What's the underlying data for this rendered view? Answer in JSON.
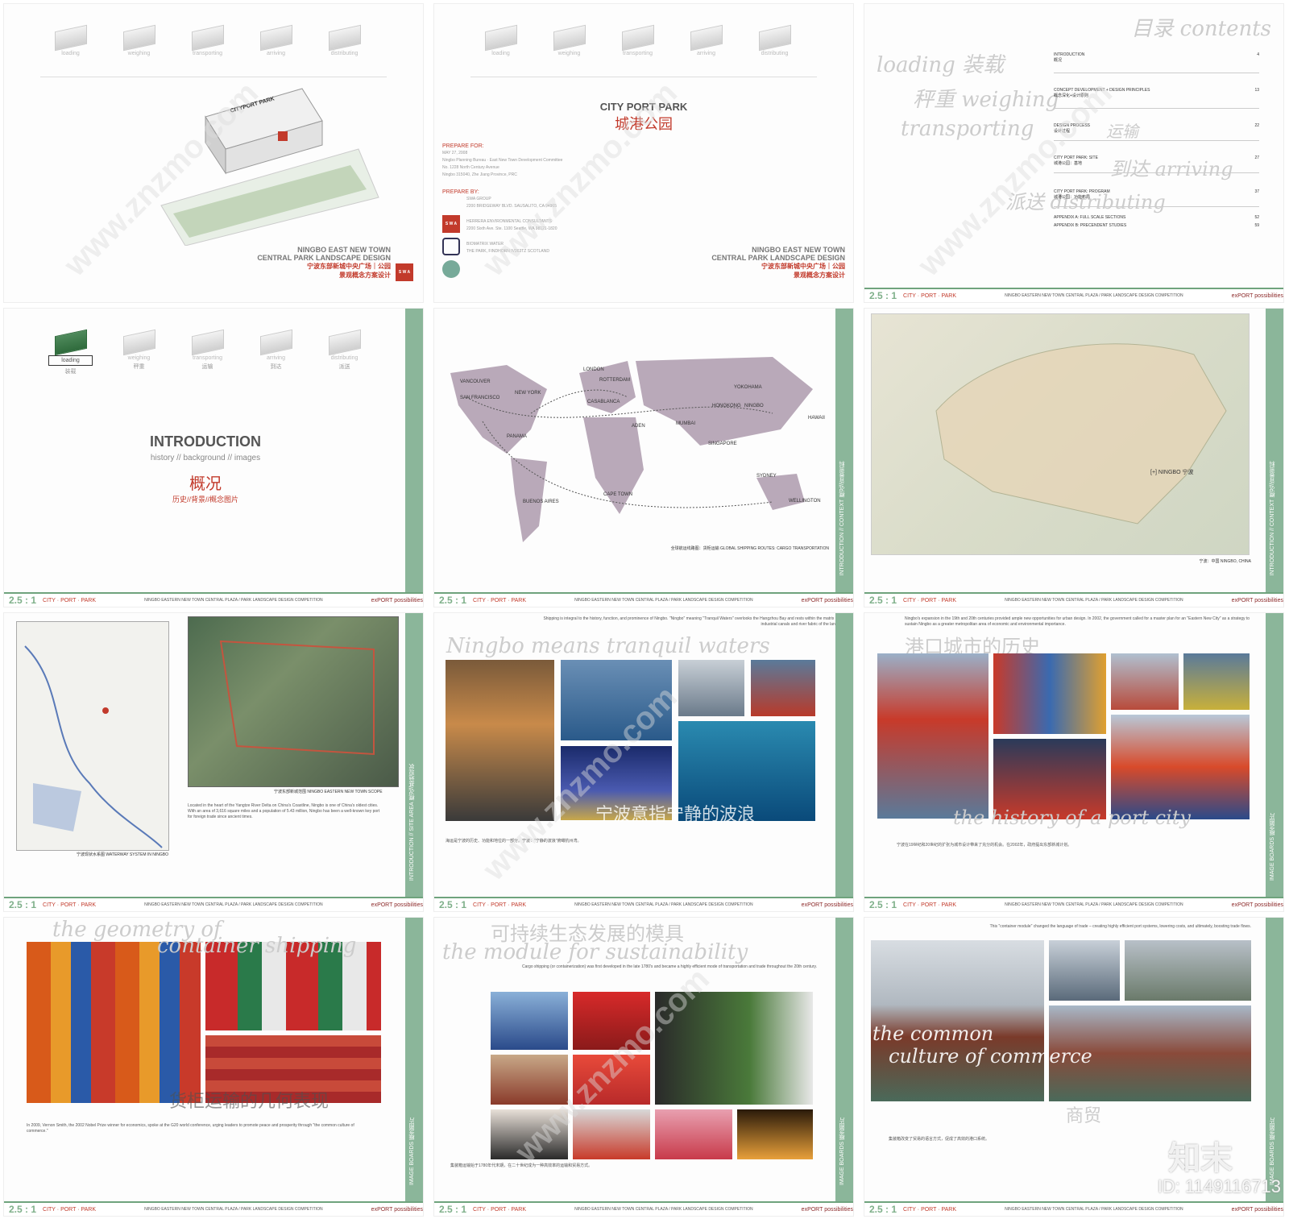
{
  "steps": [
    {
      "en": "loading",
      "cn": "装载"
    },
    {
      "en": "weighing",
      "cn": "秤重"
    },
    {
      "en": "transporting",
      "cn": "运输"
    },
    {
      "en": "arriving",
      "cn": "到达"
    },
    {
      "en": "distributing",
      "cn": "派送"
    }
  ],
  "cover": {
    "t1": "NINGBO EAST NEW TOWN",
    "t2": "CENTRAL PARK LANDSCAPE DESIGN",
    "t3": "宁波东部新城中央广场｜公园",
    "t4": "景观概念方案设计",
    "box_label": "CITYPORT PARK",
    "swa": "S W A"
  },
  "title_page": {
    "en": "CITY PORT PARK",
    "cn": "城港公园",
    "prepare_for": "PREPARE FOR:",
    "prepare_by": "PREPARE BY:",
    "date": "MAY 27, 2008",
    "client1": "Ningbo Planning Bureau · East New Town Development Committee",
    "client2": "No. 1228 North Century Avenue",
    "client3": "Ningbo 315040, Zhe Jiang Province, PRC",
    "by1": "SWA GROUP",
    "by2": "2200 BRIDGEWAY BLVD. SAUSALITO, CA 94965",
    "by3": "HERRERA ENVIRONMENTAL CONSULTANTS",
    "by4": "2200 Sixth Ave. Ste. 1100 Seattle, WA 98121-1820",
    "by5": "BIOMATRIX WATER",
    "by6": "THE PARK, FINDHORN IV363TZ SCOTLAND"
  },
  "contents": {
    "title": "目录 contents",
    "words": [
      "loading 装载",
      "秤重 weighing",
      "transporting",
      "运输",
      "到达 arriving",
      "派送 distributing"
    ],
    "items": [
      {
        "label": "INTRODUCTION",
        "sub": "概况",
        "page": "4"
      },
      {
        "label": "CONCEPT DEVELOPMENT + DESIGN PRINCIPLES",
        "sub": "概念深化+设计原则",
        "page": "13"
      },
      {
        "label": "DESIGN PROCESS",
        "sub": "设计过程",
        "page": "22"
      },
      {
        "label": "CITY PORT PARK: SITE",
        "sub": "城港公园：基地",
        "page": "27"
      },
      {
        "label": "CITY PORT PARK: PROGRAM",
        "sub": "城港公园：功能布局",
        "page": "37"
      },
      {
        "label": "APPENDIX A:  FULL SCALE SECTIONS",
        "sub": "附件A：全尺寸剖面",
        "page": "52"
      },
      {
        "label": "APPENDIX B:  PRECENDENT STUDIES",
        "sub": "附件B：案例研究",
        "page": "59"
      }
    ]
  },
  "intro": {
    "title": "INTRODUCTION",
    "sub": "history // background // images",
    "cn": "概况",
    "cn_sub": "历史//背景//概念图片",
    "box_label": "loading",
    "box_cn": "装载"
  },
  "world_map": {
    "caption": "全球航运线路图：货柜运输  GLOBAL SHIPPING ROUTES: CARGO TRANSPORTATION",
    "side": "INTRODUCTION // CONTEXT 概况//背景资料",
    "cities": [
      "VANCOUVER",
      "SAN FRANCISCO",
      "NEW YORK",
      "LONDON",
      "ROTTERDAM",
      "CASABLANCA",
      "PANAMA",
      "ADEN",
      "MUMBAI",
      "HONGKONG",
      "NINGBO",
      "YOKOHAMA",
      "HAWAII",
      "SINGAPORE",
      "SYDNEY",
      "WELLINGTON",
      "BUENOS AIRES",
      "CAPE TOWN"
    ]
  },
  "china_map": {
    "label": "[+] NINGBO 宁波",
    "caption": "宁波：中国   NINGBO, CHINA",
    "side": "INTRODUCTION // CONTEXT 概况//背景资料"
  },
  "site": {
    "cap1": "宁波现状水系图   WATERWAY SYSTEM IN NINGBO",
    "cap2": "宁波东部新城范围   NINGBO EASTERN NEW TOWN SCOPE",
    "para": "Located in the heart of the Yangtze River Delta on China's Coastline, Ningbo is one of China's oldest cities. With an area of 3,616 square miles and a population of 5.43 million, Ningbo has been a well-known key port for foreign trade since ancient times.",
    "side": "INTRODUCTION // SITE AREA 概况//基地现状"
  },
  "tranquil": {
    "title": "Ningbo means tranquil waters",
    "cn": "宁波意指宁静的波浪",
    "para": "Shipping is integral to the history, function, and prominence of Ningbo. \"Ningbo\" meaning \"Tranquil Waters\" overlooks the Hangzhou Bay and rests within the matrix of industrial canals and river fabric of the land.",
    "bottom": "海运是宁波的历史、功能和地位的一部分。宁波：\"宁静的波浪\"俯瞰杭州湾。"
  },
  "history": {
    "cn": "港口城市的历史",
    "en": "the history of a port city",
    "para": "Ningbo's expansion in the 19th and 20th centuries provided ample new opportunities for urban design. In 2002, the government called for a master plan for an \"Eastern New City\" as a strategy to sustain Ningbo as a greater metropolitan area of economic and environmental importance.",
    "bottom": "宁波在19世纪和20世纪的扩张为城市设计带来了充分的机会。在2002年，政府提出东部新城计划。",
    "side": "IMAGE BOARDS 概念图片"
  },
  "geometry": {
    "en1": "the geometry of",
    "en2": "container shipping",
    "cn": "货柜运输的几何表现",
    "para": "In 2009, Vernon Smith, the 2002 Nobel Prize winner for economics, spoke at the G20 world conference, urging leaders to promote peace and prosperity through \"the common culture of commerce.\"",
    "side": "IMAGE BOARDS 概念图片"
  },
  "module": {
    "cn": "可持续生态发展的模具",
    "en": "the module for sustainability",
    "para": "Cargo shipping (or containerization) was first developed in the late 1780's and became a highly efficient mode of transportation and trade throughout the 20th century.",
    "bottom": "集装箱运输始于1780年代末期，在二十世纪成为一种高效率的运输和贸易方式。",
    "side": "IMAGE BOARDS 概念图片"
  },
  "commerce": {
    "en1": "the common",
    "en2": "culture of commerce",
    "cn": "商贸",
    "para": "This \"container module\" changed the language of trade – creating highly efficient port systems, lowering costs, and ultimately, boosting trade flows.",
    "bottom": "集装箱改变了贸易的语言方式，促成了高效的港口系统。",
    "side": "IMAGE BOARDS 概念图片"
  },
  "footer": {
    "logo": "2.5 : 1",
    "brand": "CITY · PORT · PARK",
    "mid": "NINGBO EASTERN NEW TOWN CENTRAL PLAZA / PARK LANDSCAPE DESIGN COMPETITION",
    "right": "exPORT possibilities"
  },
  "watermark": {
    "site": "www.znzmo.com",
    "brand": "知末",
    "id": "ID: 1149116713"
  },
  "colors": {
    "accent": "#c23a2b",
    "green": "#8bb69a",
    "mapfill": "#b9a9b9"
  }
}
